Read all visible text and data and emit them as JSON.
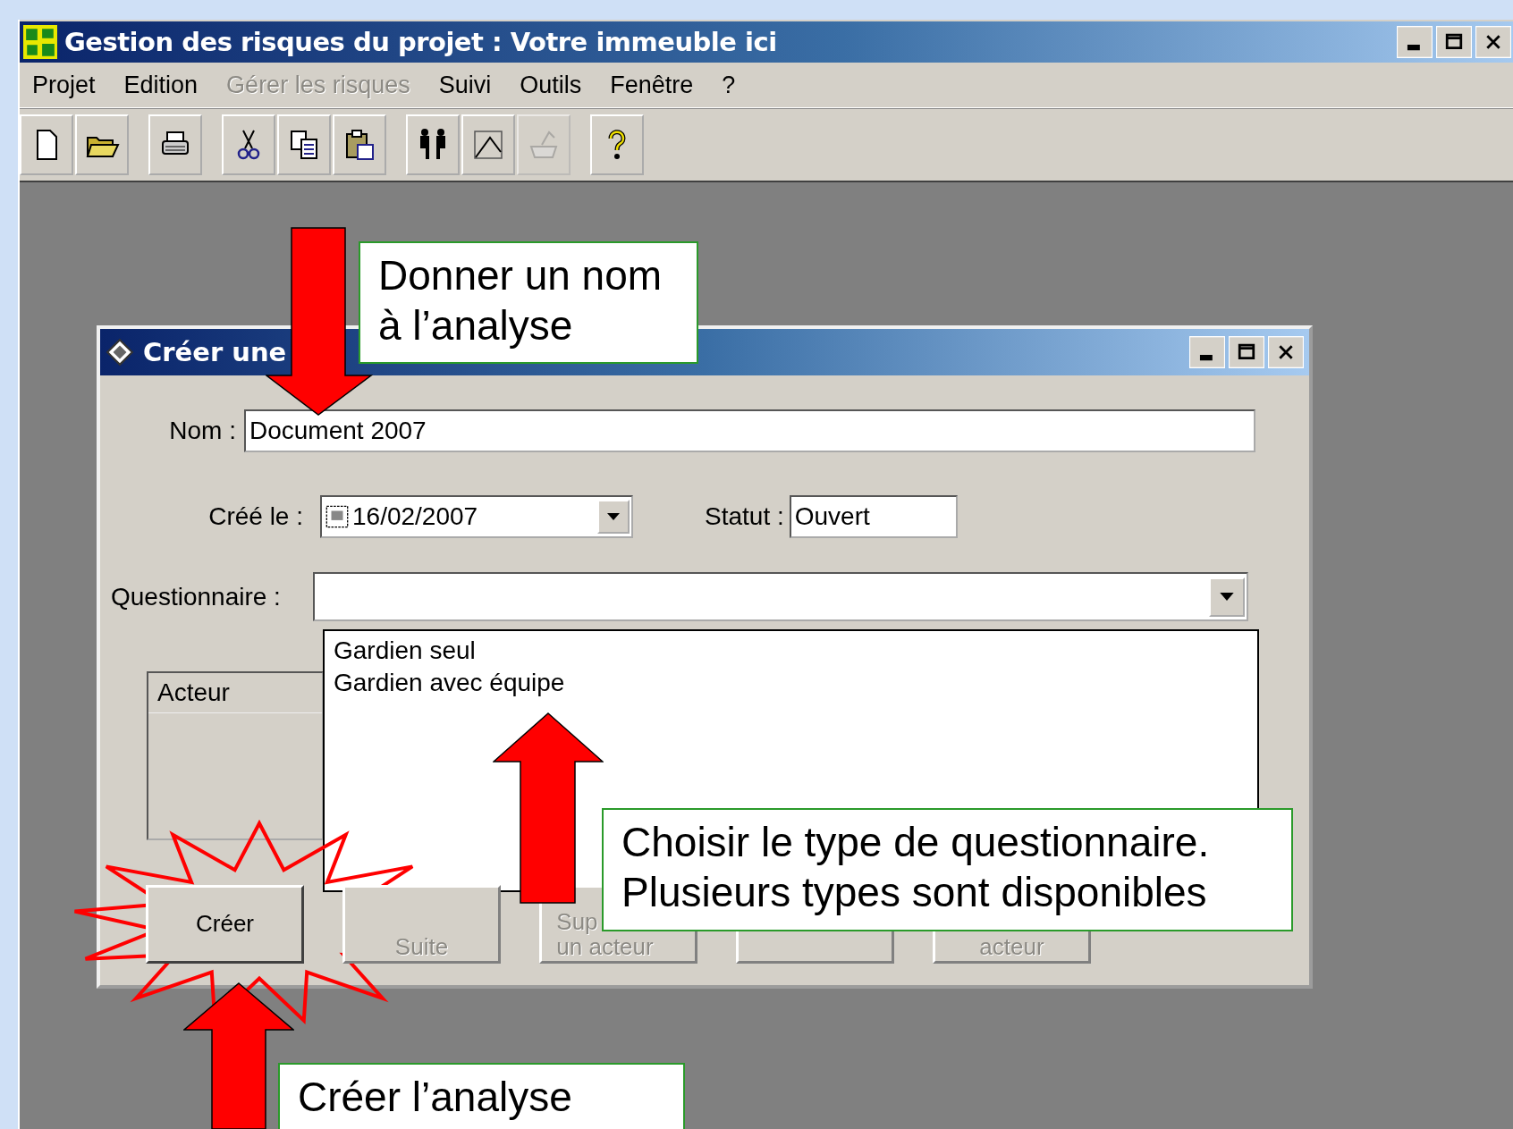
{
  "window": {
    "title": "Gestion des risques du projet : Votre immeuble ici"
  },
  "menu": [
    {
      "label": "Projet",
      "disabled": false
    },
    {
      "label": "Edition",
      "disabled": false
    },
    {
      "label": "Gérer les risques",
      "disabled": true
    },
    {
      "label": "Suivi",
      "disabled": false
    },
    {
      "label": "Outils",
      "disabled": false
    },
    {
      "label": "Fenêtre",
      "disabled": false
    },
    {
      "label": "?",
      "disabled": false
    }
  ],
  "toolbar": [
    {
      "disabled": false
    },
    {
      "disabled": false
    },
    {
      "disabled": false
    },
    {
      "disabled": false
    },
    {
      "disabled": false
    },
    {
      "disabled": false
    },
    {
      "disabled": false
    },
    {
      "disabled": false
    },
    {
      "disabled": true
    },
    {
      "disabled": false
    }
  ],
  "dialog": {
    "title": "Créer une",
    "nom": {
      "label": "Nom :",
      "value": "Document 2007"
    },
    "cree_le": {
      "label": "Créé le :",
      "value": "16/02/2007"
    },
    "statut": {
      "label": "Statut :",
      "value": "Ouvert"
    },
    "questionnaire": {
      "label": "Questionnaire :",
      "options": [
        "Gardien seul",
        "Gardien avec équipe"
      ]
    },
    "actor_list": {
      "column": "Acteur"
    },
    "buttons": [
      {
        "lines": [
          "Créer"
        ],
        "disabled": false
      },
      {
        "lines": [
          "Suite"
        ],
        "disabled": true
      },
      {
        "lines": [
          "Sup",
          "un acteur"
        ],
        "disabled": true
      },
      {
        "disabled": true
      },
      {
        "lines": [
          "acteur"
        ],
        "disabled": true
      }
    ]
  },
  "callouts": [
    {
      "lines": [
        "Donner un nom",
        "à l’analyse"
      ]
    },
    {
      "lines": [
        "Choisir le type de questionnaire.",
        "Plusieurs types sont disponibles"
      ]
    },
    {
      "lines": [
        "Créer l’analyse"
      ]
    }
  ]
}
